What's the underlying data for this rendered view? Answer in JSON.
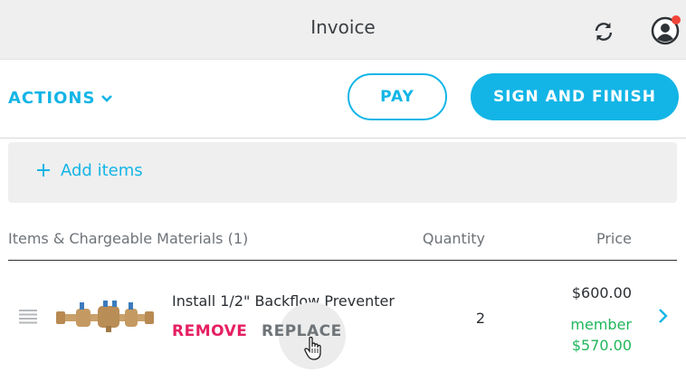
{
  "header": {
    "title": "Invoice",
    "sync_icon": "sync-icon",
    "avatar_icon": "user-avatar-icon",
    "notification_color": "#f04438"
  },
  "toolbar": {
    "actions_label": "ACTIONS",
    "pay_label": "PAY",
    "sign_label": "SIGN AND FINISH",
    "accent_color": "#13b5e6"
  },
  "add_items": {
    "label": "Add items"
  },
  "table": {
    "headers": {
      "items": "Items & Chargeable Materials (1)",
      "quantity": "Quantity",
      "price": "Price"
    },
    "rows": [
      {
        "name": "Install 1/2\" Backflow Preventer",
        "remove_label": "REMOVE",
        "replace_label": "REPLACE",
        "quantity": "2",
        "price": "$600.00",
        "member_label": "member",
        "member_price": "$570.00"
      }
    ]
  },
  "colors": {
    "remove": "#e61f63",
    "member": "#20b65c"
  }
}
